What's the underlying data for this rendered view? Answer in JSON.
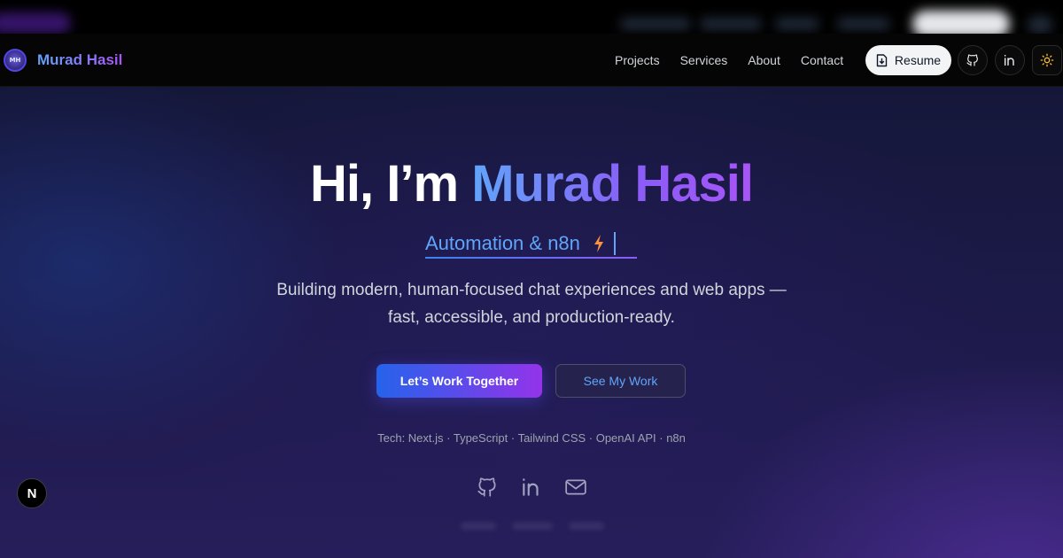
{
  "nav": {
    "brand_initials": "MH",
    "brand_name": "Murad Hasil",
    "links": [
      "Projects",
      "Services",
      "About",
      "Contact"
    ],
    "resume_label": "Resume"
  },
  "hero": {
    "greeting": "Hi, I’m ",
    "name": "Murad Hasil",
    "typed_text": "Automation & n8n",
    "subtitle_line1": "Building modern, human-focused chat experiences and web apps —",
    "subtitle_line2": "fast, accessible, and production-ready.",
    "primary_cta": "Let’s Work Together",
    "secondary_cta": "See My Work",
    "tech": "Tech: Next.js · TypeScript · Tailwind CSS · OpenAI API · n8n"
  },
  "next_badge": "N",
  "icons": {
    "resume": "file-download-icon",
    "github": "github-icon",
    "linkedin": "linkedin-icon",
    "theme": "sun-icon",
    "email": "mail-icon",
    "typed": "lightning-bolt-icon"
  },
  "colors": {
    "accent_blue": "#60a5fa",
    "accent_purple": "#a855f7",
    "background": "#1d1a4a"
  }
}
